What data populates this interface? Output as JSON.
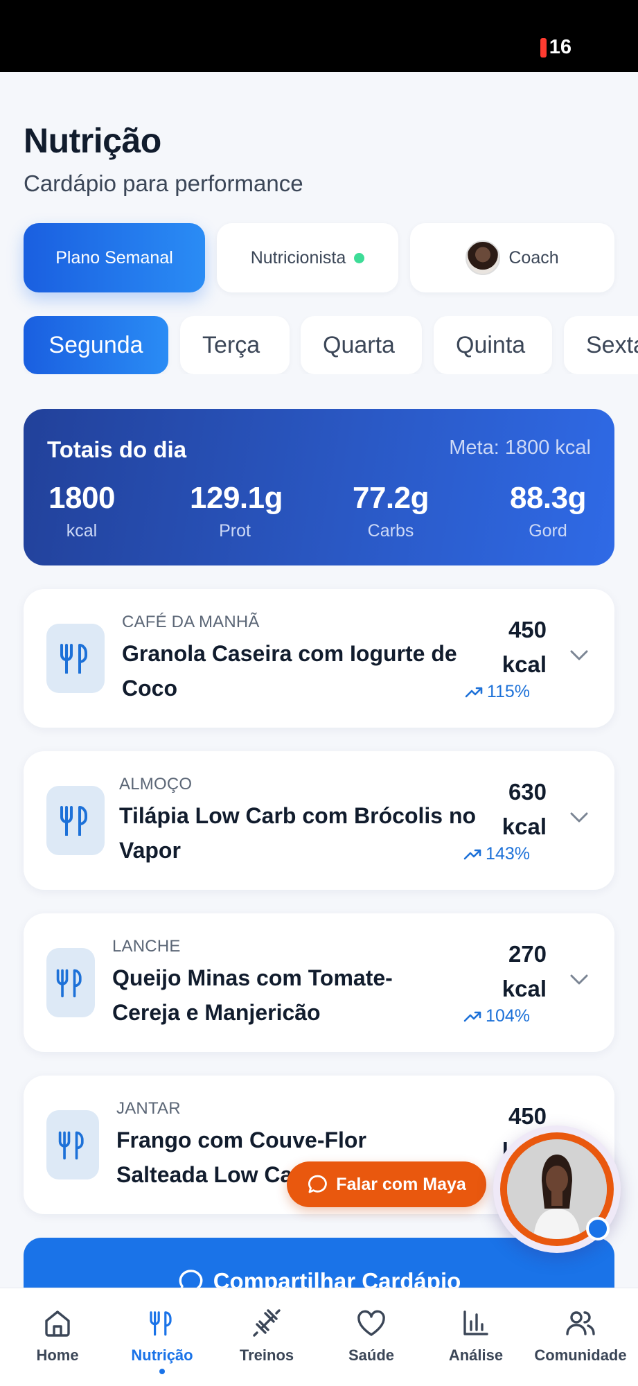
{
  "status_bar": {
    "battery": "16"
  },
  "header": {
    "title": "Nutrição",
    "subtitle": "Cardápio para performance"
  },
  "segments": {
    "plan": "Plano Semanal",
    "nutritionist": "Nutricionista",
    "coach": "Coach"
  },
  "days": [
    "Segunda",
    "Terça",
    "Quarta",
    "Quinta",
    "Sexta"
  ],
  "totals": {
    "title": "Totais do dia",
    "goal": "Meta: 1800 kcal",
    "metrics": [
      {
        "value": "1800",
        "label": "kcal"
      },
      {
        "value": "129.1g",
        "label": "Prot"
      },
      {
        "value": "77.2g",
        "label": "Carbs"
      },
      {
        "value": "88.3g",
        "label": "Gord"
      }
    ]
  },
  "meals": [
    {
      "category": "CAFÉ DA MANHÃ",
      "name": "Granola Caseira com Iogurte de Coco",
      "kcal": "450",
      "unit": "kcal",
      "percent": "115%"
    },
    {
      "category": "ALMOÇO",
      "name": "Tilápia Low Carb com Brócolis no Vapor",
      "kcal": "630",
      "unit": "kcal",
      "percent": "143%"
    },
    {
      "category": "LANCHE",
      "name": "Queijo Minas com Tomate-Cereja e Manjericão",
      "kcal": "270",
      "unit": "kcal",
      "percent": "104%"
    },
    {
      "category": "JANTAR",
      "name": "Frango com Couve-Flor Salteada Low Carb",
      "kcal": "450",
      "unit": "kcal",
      "percent": ""
    }
  ],
  "share_button": "Compartilhar Cardápio",
  "maya_button": "Falar com Maya",
  "tabbar": [
    {
      "label": "Home",
      "icon": "home-icon"
    },
    {
      "label": "Nutrição",
      "icon": "utensils-icon"
    },
    {
      "label": "Treinos",
      "icon": "dumbbell-icon"
    },
    {
      "label": "Saúde",
      "icon": "heart-icon"
    },
    {
      "label": "Análise",
      "icon": "bar-chart-icon"
    },
    {
      "label": "Comunidade",
      "icon": "users-icon"
    }
  ],
  "colors": {
    "accent": "#1a73e8",
    "orange": "#e9580e",
    "totals_bg": "#2a58c4"
  }
}
